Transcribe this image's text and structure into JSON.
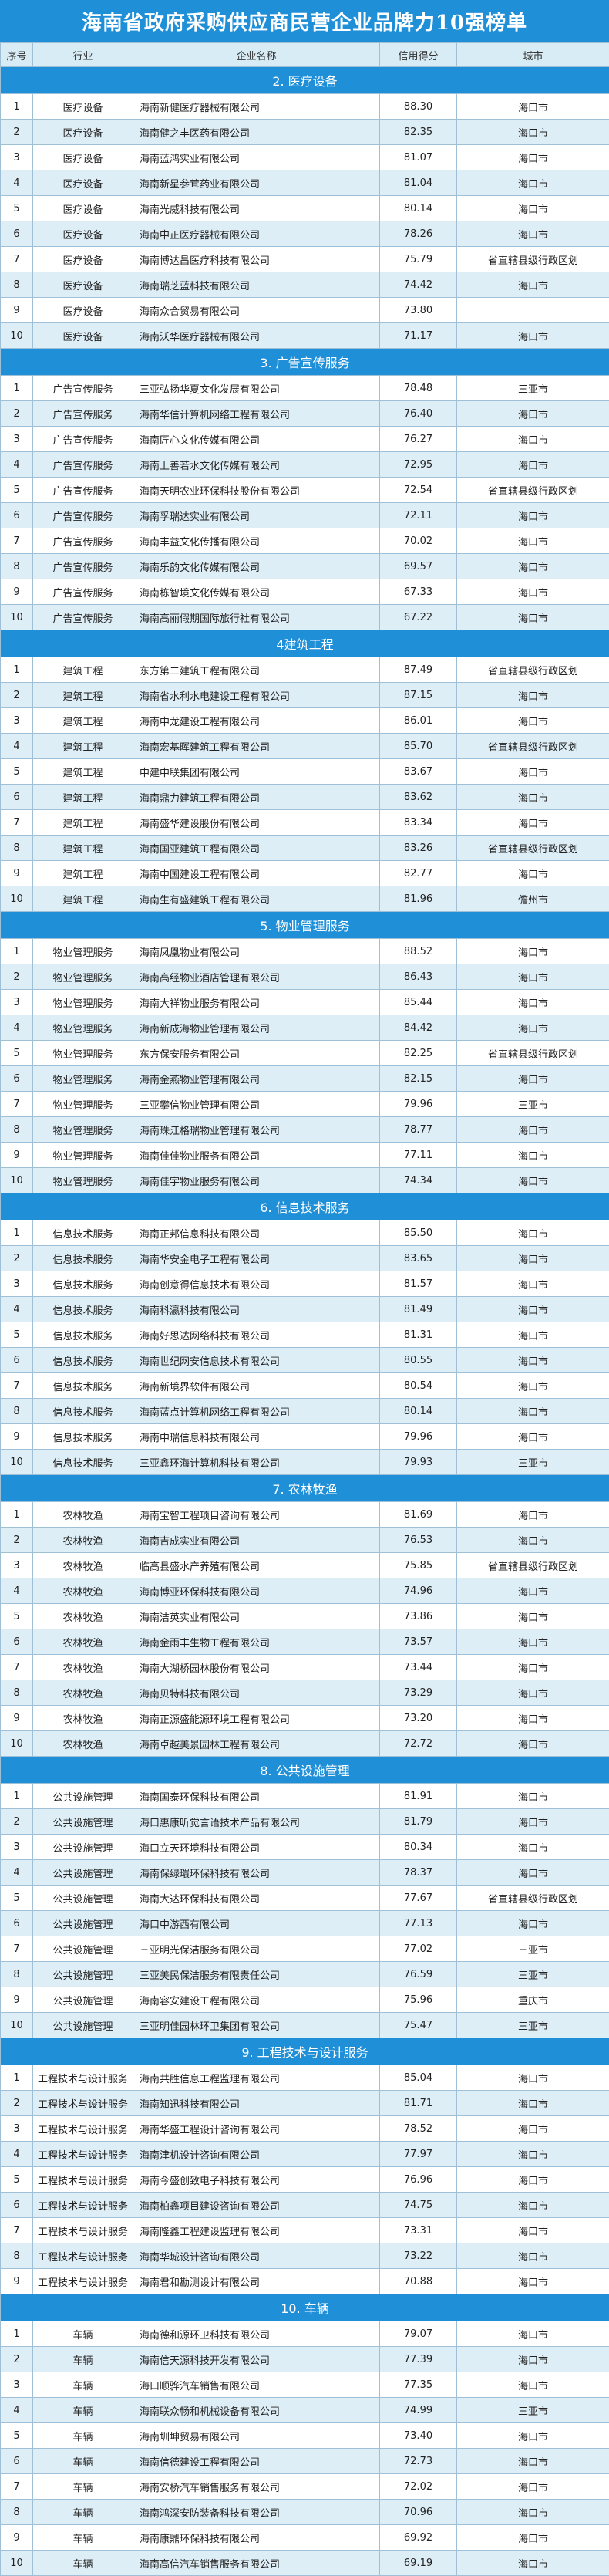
{
  "title": "海南省政府采购供应商民营企业品牌力10强榜单",
  "headers": {
    "no": "序号",
    "industry": "行业",
    "name": "企业名称",
    "score": "信用得分",
    "city": "城市"
  },
  "sections": [
    {
      "title": "2. 医疗设备",
      "rows": [
        [
          "1",
          "医疗设备",
          "海南新健医疗器械有限公司",
          "88.30",
          "海口市"
        ],
        [
          "2",
          "医疗设备",
          "海南健之丰医药有限公司",
          "82.35",
          "海口市"
        ],
        [
          "3",
          "医疗设备",
          "海南蓝鸿实业有限公司",
          "81.07",
          "海口市"
        ],
        [
          "4",
          "医疗设备",
          "海南新星参茸药业有限公司",
          "81.04",
          "海口市"
        ],
        [
          "5",
          "医疗设备",
          "海南光威科技有限公司",
          "80.14",
          "海口市"
        ],
        [
          "6",
          "医疗设备",
          "海南中正医疗器械有限公司",
          "78.26",
          "海口市"
        ],
        [
          "7",
          "医疗设备",
          "海南博达昌医疗科技有限公司",
          "75.79",
          "省直辖县级行政区划"
        ],
        [
          "8",
          "医疗设备",
          "海南瑞芝蓝科技有限公司",
          "74.42",
          "海口市"
        ],
        [
          "9",
          "医疗设备",
          "海南众合贸易有限公司",
          "73.80",
          ""
        ],
        [
          "10",
          "医疗设备",
          "海南沃华医疗器械有限公司",
          "71.17",
          "海口市"
        ]
      ]
    },
    {
      "title": "3. 广告宣传服务",
      "rows": [
        [
          "1",
          "广告宣传服务",
          "三亚弘扬华夏文化发展有限公司",
          "78.48",
          "三亚市"
        ],
        [
          "2",
          "广告宣传服务",
          "海南华信计算机网络工程有限公司",
          "76.40",
          "海口市"
        ],
        [
          "3",
          "广告宣传服务",
          "海南匠心文化传媒有限公司",
          "76.27",
          "海口市"
        ],
        [
          "4",
          "广告宣传服务",
          "海南上善若水文化传媒有限公司",
          "72.95",
          "海口市"
        ],
        [
          "5",
          "广告宣传服务",
          "海南天明农业环保科技股份有限公司",
          "72.54",
          "省直辖县级行政区划"
        ],
        [
          "6",
          "广告宣传服务",
          "海南孚瑞达实业有限公司",
          "72.11",
          "海口市"
        ],
        [
          "7",
          "广告宣传服务",
          "海南丰益文化传播有限公司",
          "70.02",
          "海口市"
        ],
        [
          "8",
          "广告宣传服务",
          "海南乐韵文化传媒有限公司",
          "69.57",
          "海口市"
        ],
        [
          "9",
          "广告宣传服务",
          "海南栋智境文化传媒有限公司",
          "67.33",
          "海口市"
        ],
        [
          "10",
          "广告宣传服务",
          "海南高丽假期国际旅行社有限公司",
          "67.22",
          "海口市"
        ]
      ]
    },
    {
      "title": "4建筑工程",
      "rows": [
        [
          "1",
          "建筑工程",
          "东方第二建筑工程有限公司",
          "87.49",
          "省直辖县级行政区划"
        ],
        [
          "2",
          "建筑工程",
          "海南省水利水电建设工程有限公司",
          "87.15",
          "海口市"
        ],
        [
          "3",
          "建筑工程",
          "海南中龙建设工程有限公司",
          "86.01",
          "海口市"
        ],
        [
          "4",
          "建筑工程",
          "海南宏基晖建筑工程有限公司",
          "85.70",
          "省直辖县级行政区划"
        ],
        [
          "5",
          "建筑工程",
          "中建中联集团有限公司",
          "83.67",
          "海口市"
        ],
        [
          "6",
          "建筑工程",
          "海南鼎力建筑工程有限公司",
          "83.62",
          "海口市"
        ],
        [
          "7",
          "建筑工程",
          "海南盛华建设股份有限公司",
          "83.34",
          "海口市"
        ],
        [
          "8",
          "建筑工程",
          "海南国亚建筑工程有限公司",
          "83.26",
          "省直辖县级行政区划"
        ],
        [
          "9",
          "建筑工程",
          "海南中国建设工程有限公司",
          "82.77",
          "海口市"
        ],
        [
          "10",
          "建筑工程",
          "海南生有盛建筑工程有限公司",
          "81.96",
          "儋州市"
        ]
      ]
    },
    {
      "title": "5. 物业管理服务",
      "rows": [
        [
          "1",
          "物业管理服务",
          "海南凤凰物业有限公司",
          "88.52",
          "海口市"
        ],
        [
          "2",
          "物业管理服务",
          "海南高经物业酒店管理有限公司",
          "86.43",
          "海口市"
        ],
        [
          "3",
          "物业管理服务",
          "海南大祥物业服务有限公司",
          "85.44",
          "海口市"
        ],
        [
          "4",
          "物业管理服务",
          "海南新成海物业管理有限公司",
          "84.42",
          "海口市"
        ],
        [
          "5",
          "物业管理服务",
          "东方保安服务有限公司",
          "82.25",
          "省直辖县级行政区划"
        ],
        [
          "6",
          "物业管理服务",
          "海南金燕物业管理有限公司",
          "82.15",
          "海口市"
        ],
        [
          "7",
          "物业管理服务",
          "三亚攀信物业管理有限公司",
          "79.96",
          "三亚市"
        ],
        [
          "8",
          "物业管理服务",
          "海南珠江格瑞物业管理有限公司",
          "78.77",
          "海口市"
        ],
        [
          "9",
          "物业管理服务",
          "海南佳佳物业服务有限公司",
          "77.11",
          "海口市"
        ],
        [
          "10",
          "物业管理服务",
          "海南佳宇物业服务有限公司",
          "74.34",
          "海口市"
        ]
      ]
    },
    {
      "title": "6. 信息技术服务",
      "rows": [
        [
          "1",
          "信息技术服务",
          "海南正邦信息科技有限公司",
          "85.50",
          "海口市"
        ],
        [
          "2",
          "信息技术服务",
          "海南华安金电子工程有限公司",
          "83.65",
          "海口市"
        ],
        [
          "3",
          "信息技术服务",
          "海南创意得信息技术有限公司",
          "81.57",
          "海口市"
        ],
        [
          "4",
          "信息技术服务",
          "海南科瀛科技有限公司",
          "81.49",
          "海口市"
        ],
        [
          "5",
          "信息技术服务",
          "海南好思达网络科技有限公司",
          "81.31",
          "海口市"
        ],
        [
          "6",
          "信息技术服务",
          "海南世纪网安信息技术有限公司",
          "80.55",
          "海口市"
        ],
        [
          "7",
          "信息技术服务",
          "海南新境界软件有限公司",
          "80.54",
          "海口市"
        ],
        [
          "8",
          "信息技术服务",
          "海南蓝点计算机网络工程有限公司",
          "80.14",
          "海口市"
        ],
        [
          "9",
          "信息技术服务",
          "海南中瑞信息科技有限公司",
          "79.96",
          "海口市"
        ],
        [
          "10",
          "信息技术服务",
          "三亚鑫环海计算机科技有限公司",
          "79.93",
          "三亚市"
        ]
      ]
    },
    {
      "title": "7. 农林牧渔",
      "rows": [
        [
          "1",
          "农林牧渔",
          "海南宝智工程项目咨询有限公司",
          "81.69",
          "海口市"
        ],
        [
          "2",
          "农林牧渔",
          "海南吉成实业有限公司",
          "76.53",
          "海口市"
        ],
        [
          "3",
          "农林牧渔",
          "临高县盛水产养殖有限公司",
          "75.85",
          "省直辖县级行政区划"
        ],
        [
          "4",
          "农林牧渔",
          "海南博亚环保科技有限公司",
          "74.96",
          "海口市"
        ],
        [
          "5",
          "农林牧渔",
          "海南洁英实业有限公司",
          "73.86",
          "海口市"
        ],
        [
          "6",
          "农林牧渔",
          "海南金雨丰生物工程有限公司",
          "73.57",
          "海口市"
        ],
        [
          "7",
          "农林牧渔",
          "海南大湖桥园林股份有限公司",
          "73.44",
          "海口市"
        ],
        [
          "8",
          "农林牧渔",
          "海南贝特科技有限公司",
          "73.29",
          "海口市"
        ],
        [
          "9",
          "农林牧渔",
          "海南正源盛能源环境工程有限公司",
          "73.20",
          "海口市"
        ],
        [
          "10",
          "农林牧渔",
          "海南卓越美景园林工程有限公司",
          "72.72",
          "海口市"
        ]
      ]
    },
    {
      "title": "8. 公共设施管理",
      "rows": [
        [
          "1",
          "公共设施管理",
          "海南国泰环保科技有限公司",
          "81.91",
          "海口市"
        ],
        [
          "2",
          "公共设施管理",
          "海口惠康听觉言语技术产品有限公司",
          "81.79",
          "海口市"
        ],
        [
          "3",
          "公共设施管理",
          "海口立天环境科技有限公司",
          "80.34",
          "海口市"
        ],
        [
          "4",
          "公共设施管理",
          "海南保绿環环保科技有限公司",
          "78.37",
          "海口市"
        ],
        [
          "5",
          "公共设施管理",
          "海南大达环保科技有限公司",
          "77.67",
          "省直辖县级行政区划"
        ],
        [
          "6",
          "公共设施管理",
          "海口中游西有限公司",
          "77.13",
          "海口市"
        ],
        [
          "7",
          "公共设施管理",
          "三亚明光保洁服务有限公司",
          "77.02",
          "三亚市"
        ],
        [
          "8",
          "公共设施管理",
          "三亚美民保洁服务有限责任公司",
          "76.59",
          "三亚市"
        ],
        [
          "9",
          "公共设施管理",
          "海南容安建设工程有限公司",
          "75.96",
          "重庆市"
        ],
        [
          "10",
          "公共设施管理",
          "三亚明佳园林环卫集团有限公司",
          "75.47",
          "三亚市"
        ]
      ]
    },
    {
      "title": "9. 工程技术与设计服务",
      "rows": [
        [
          "1",
          "工程技术与设计服务",
          "海南共胜信息工程监理有限公司",
          "85.04",
          "海口市"
        ],
        [
          "2",
          "工程技术与设计服务",
          "海南知迅科技有限公司",
          "81.71",
          "海口市"
        ],
        [
          "3",
          "工程技术与设计服务",
          "海南华盛工程设计咨询有限公司",
          "78.52",
          "海口市"
        ],
        [
          "4",
          "工程技术与设计服务",
          "海南津机设计咨询有限公司",
          "77.97",
          "海口市"
        ],
        [
          "5",
          "工程技术与设计服务",
          "海南今盛创致电子科技有限公司",
          "76.96",
          "海口市"
        ],
        [
          "6",
          "工程技术与设计服务",
          "海南柏鑫项目建设咨询有限公司",
          "74.75",
          "海口市"
        ],
        [
          "7",
          "工程技术与设计服务",
          "海南隆鑫工程建设监理有限公司",
          "73.31",
          "海口市"
        ],
        [
          "8",
          "工程技术与设计服务",
          "海南华城设计咨询有限公司",
          "73.22",
          "海口市"
        ],
        [
          "9",
          "工程技术与设计服务",
          "海南君和勘测设计有限公司",
          "70.88",
          "海口市"
        ]
      ]
    },
    {
      "title": "10. 车辆",
      "rows": [
        [
          "1",
          "车辆",
          "海南德和源环卫科技有限公司",
          "79.07",
          "海口市"
        ],
        [
          "2",
          "车辆",
          "海南信天源科技开发有限公司",
          "77.39",
          "海口市"
        ],
        [
          "3",
          "车辆",
          "海口顺骅汽车销售有限公司",
          "77.35",
          "海口市"
        ],
        [
          "4",
          "车辆",
          "海南联众畅和机械设备有限公司",
          "74.99",
          "三亚市"
        ],
        [
          "5",
          "车辆",
          "海南圳坤贸易有限公司",
          "73.40",
          "海口市"
        ],
        [
          "6",
          "车辆",
          "海南信德建设工程有限公司",
          "72.73",
          "海口市"
        ],
        [
          "7",
          "车辆",
          "海南安桥汽车销售服务有限公司",
          "72.02",
          "海口市"
        ],
        [
          "8",
          "车辆",
          "海南鸿深安防装备科技有限公司",
          "70.96",
          "海口市"
        ],
        [
          "9",
          "车辆",
          "海南康鼎环保科技有限公司",
          "69.92",
          "海口市"
        ],
        [
          "10",
          "车辆",
          "海南高信汽车销售服务有限公司",
          "69.19",
          "海口市"
        ]
      ]
    }
  ]
}
